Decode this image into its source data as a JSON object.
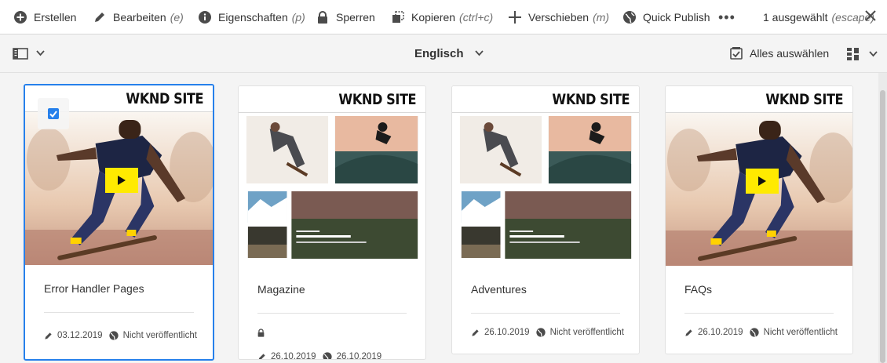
{
  "actionbar": {
    "actions": [
      {
        "label": "Erstellen",
        "hint": "",
        "icon": "plus-circle-icon"
      },
      {
        "label": "Bearbeiten",
        "hint": "(e)",
        "icon": "pencil-icon"
      },
      {
        "label": "Eigenschaften",
        "hint": "(p)",
        "icon": "info-icon"
      },
      {
        "label": "Sperren",
        "hint": "",
        "icon": "lock-icon"
      },
      {
        "label": "Kopieren",
        "hint": "(ctrl+c)",
        "icon": "copy-icon"
      },
      {
        "label": "Verschieben",
        "hint": "(m)",
        "icon": "move-icon"
      },
      {
        "label": "Quick Publish",
        "hint": "",
        "icon": "globe-icon"
      }
    ],
    "more_label": "•••",
    "selection_label": "1 ausgewählt",
    "selection_hint": "(escape)"
  },
  "toolbar": {
    "language": "Englisch",
    "select_all_label": "Alles auswählen"
  },
  "cards": [
    {
      "title": "Error Handler Pages",
      "brand": "WKND SITE",
      "date": "03.12.2019",
      "status": "Nicht veröffentlicht",
      "selected": true,
      "thumb": "skate-video"
    },
    {
      "title": "Magazine",
      "brand": "WKND SITE",
      "locked": true,
      "date": "26.10.2019",
      "published": "26.10.2019",
      "thumb": "magazine"
    },
    {
      "title": "Adventures",
      "brand": "WKND SITE",
      "date": "26.10.2019",
      "status": "Nicht veröffentlicht",
      "thumb": "magazine"
    },
    {
      "title": "FAQs",
      "brand": "WKND SITE",
      "date": "26.10.2019",
      "status": "Nicht veröffentlicht",
      "thumb": "skate-video"
    }
  ],
  "colors": {
    "accent": "#2680eb",
    "play": "#ffea00"
  }
}
